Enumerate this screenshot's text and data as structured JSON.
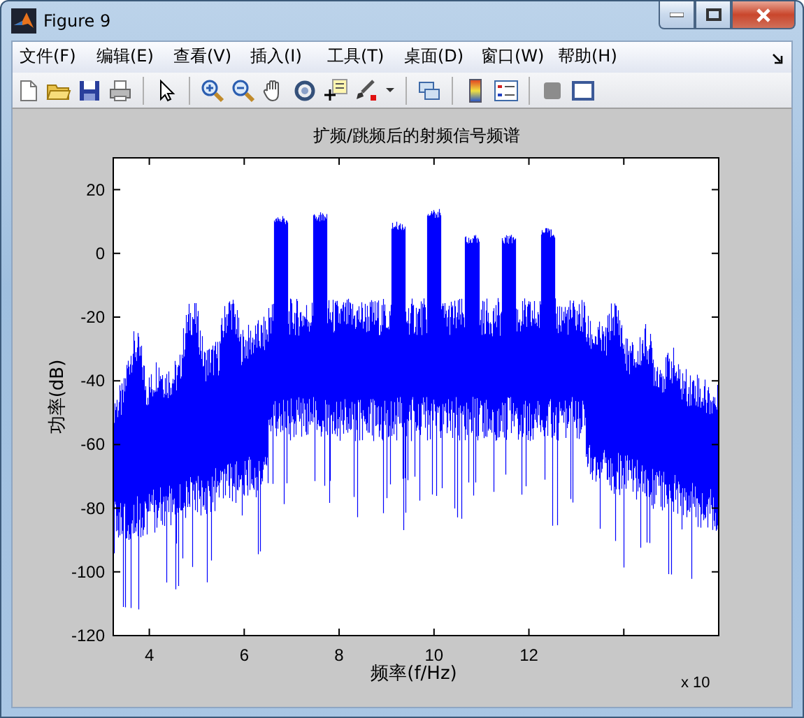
{
  "window": {
    "title": "Figure 9"
  },
  "menu": [
    "文件(F)",
    "编辑(E)",
    "查看(V)",
    "插入(I)",
    "工具(T)",
    "桌面(D)",
    "窗口(W)",
    "帮助(H)"
  ],
  "plot": {
    "title": "扩频/跳频后的射频信号频谱",
    "xlabel": "频率(f/Hz)",
    "ylabel": "功率(dB)",
    "xticks": [
      "4",
      "6",
      "8",
      "10",
      "12"
    ],
    "yticks": [
      "20",
      "0",
      "-20",
      "-40",
      "-60",
      "-80",
      "-100",
      "-120"
    ],
    "x_exponent": "x 10"
  }
}
